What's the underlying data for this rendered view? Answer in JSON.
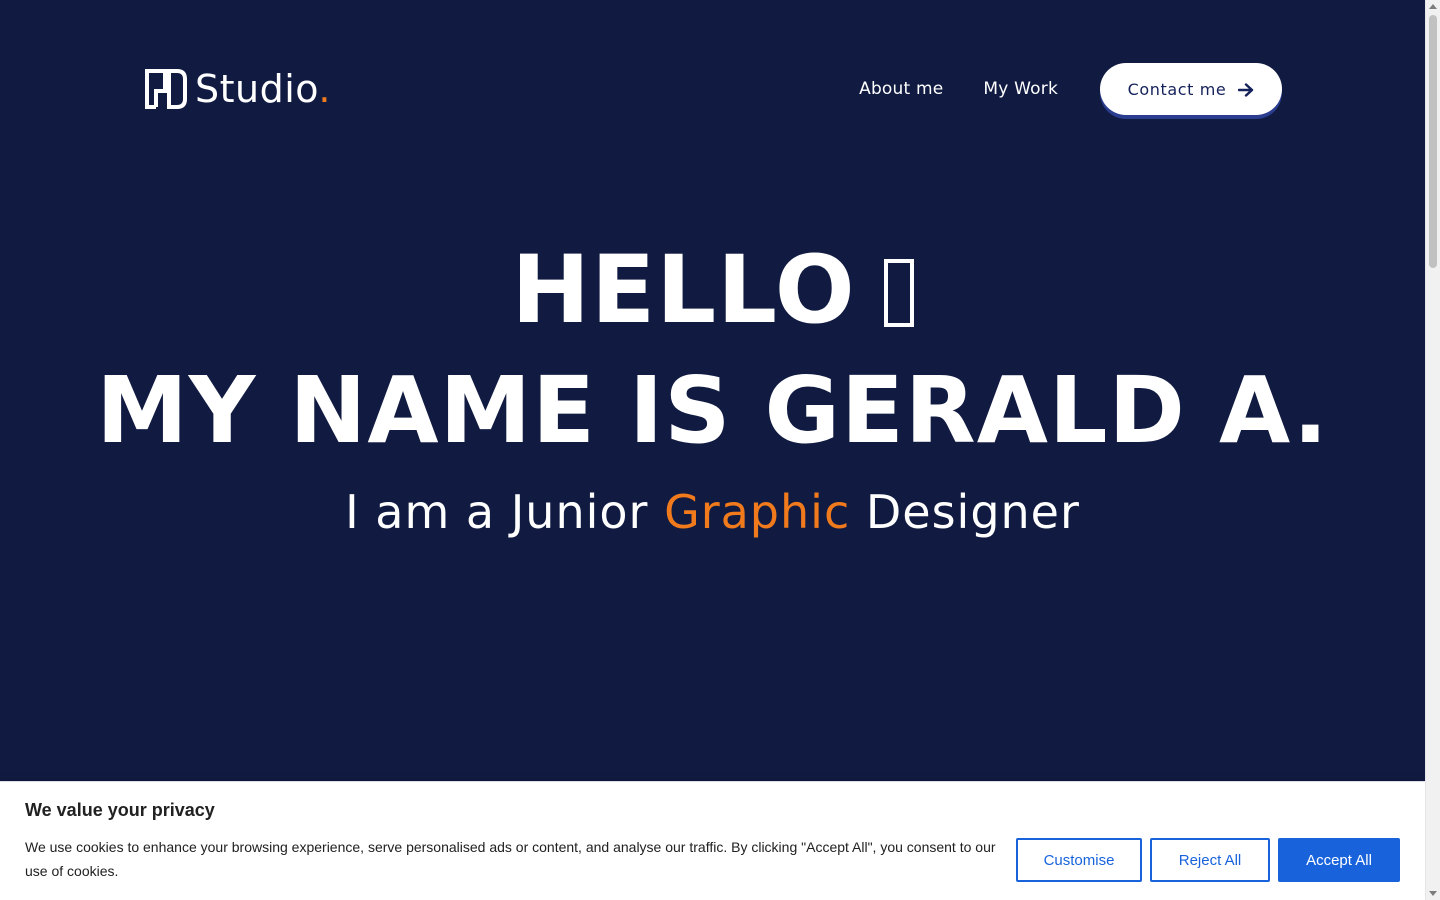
{
  "brand": {
    "logo_icon": "studio-logo-icon",
    "name": "Studio",
    "dot": ".",
    "accent_color": "#f07a1c"
  },
  "nav": {
    "items": [
      {
        "label": "About me"
      },
      {
        "label": "My Work"
      }
    ],
    "contact_label": "Contact me",
    "contact_icon": "arrow-right-icon"
  },
  "hero": {
    "line1": "HELLO",
    "line1_icon": "waving-hand-icon",
    "line2": "MY NAME IS GERALD A.",
    "line3_prefix": "I am a Junior ",
    "line3_accent": "Graphic",
    "line3_suffix": " Designer"
  },
  "cookie_banner": {
    "title": "We value your privacy",
    "text": "We use cookies to enhance your browsing experience, serve personalised ads or content, and analyse our traffic. By clicking \"Accept All\", you consent to our use of cookies.",
    "customise_label": "Customise",
    "reject_label": "Reject All",
    "accept_label": "Accept All",
    "button_color": "#1863dc"
  },
  "colors": {
    "background": "#111b42",
    "text": "#ffffff",
    "accent": "#f07a1c"
  }
}
